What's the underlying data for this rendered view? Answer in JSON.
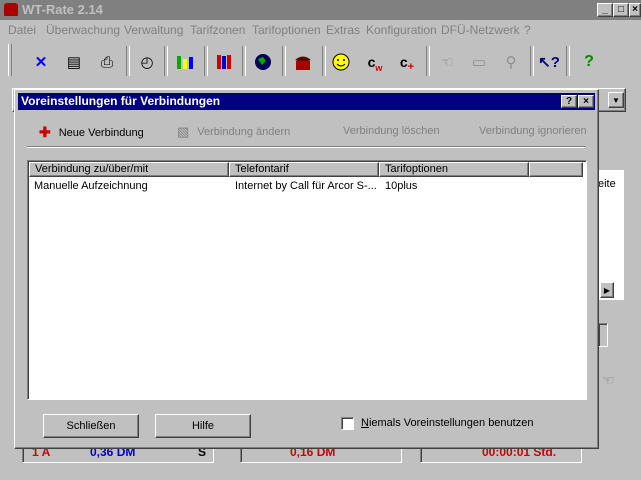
{
  "app": {
    "title": "WT-Rate 2.14"
  },
  "menu": {
    "items": [
      {
        "label": "Datei"
      },
      {
        "label": "Überwachung"
      },
      {
        "label": "Verwaltung"
      },
      {
        "label": "Tarifzonen"
      },
      {
        "label": "Tarifoptionen"
      },
      {
        "label": "Extras"
      },
      {
        "label": "Konfiguration"
      },
      {
        "label": "DFÜ-Netzwerk"
      },
      {
        "label": "?"
      }
    ]
  },
  "toolbar": {
    "icons": [
      "close-x-icon",
      "document-icon",
      "printer-icon",
      "stopwatch-icon",
      "bar-chart-icon",
      "books-icon",
      "globe-icon",
      "telephone-icon",
      "smiley-icon",
      "cost-w-icon",
      "cost-plus-icon",
      "hand-icon",
      "tape-icon",
      "magnifier-icon",
      "help-pointer-icon",
      "question-icon"
    ]
  },
  "background": {
    "bottom_left_text": "1 A",
    "bottom_left_value": "0,36 DM",
    "bottom_left_unit": "S",
    "bottom_mid_value": "0,16 DM",
    "bottom_right_value": "00:00:01 Std.",
    "right_fragment": "eite"
  },
  "dialog": {
    "title": "Voreinstellungen für Verbindungen",
    "actions": {
      "new": "Neue Verbindung",
      "edit": "Verbindung ändern",
      "delete": "Verbindung löschen",
      "ignore": "Verbindung ignorieren"
    },
    "columns": [
      "Verbindung zu/über/mit",
      "Telefontarif",
      "Tarifoptionen",
      ""
    ],
    "rows": [
      {
        "connection": "Manuelle Aufzeichnung",
        "tariff": "Internet by Call für Arcor S-...",
        "options": "10plus"
      }
    ],
    "buttons": {
      "close": "Schließen",
      "help": "Hilfe"
    },
    "checkbox": {
      "prefix": "N",
      "rest": "iemals Voreinstellungen benutzen",
      "checked": false
    }
  }
}
